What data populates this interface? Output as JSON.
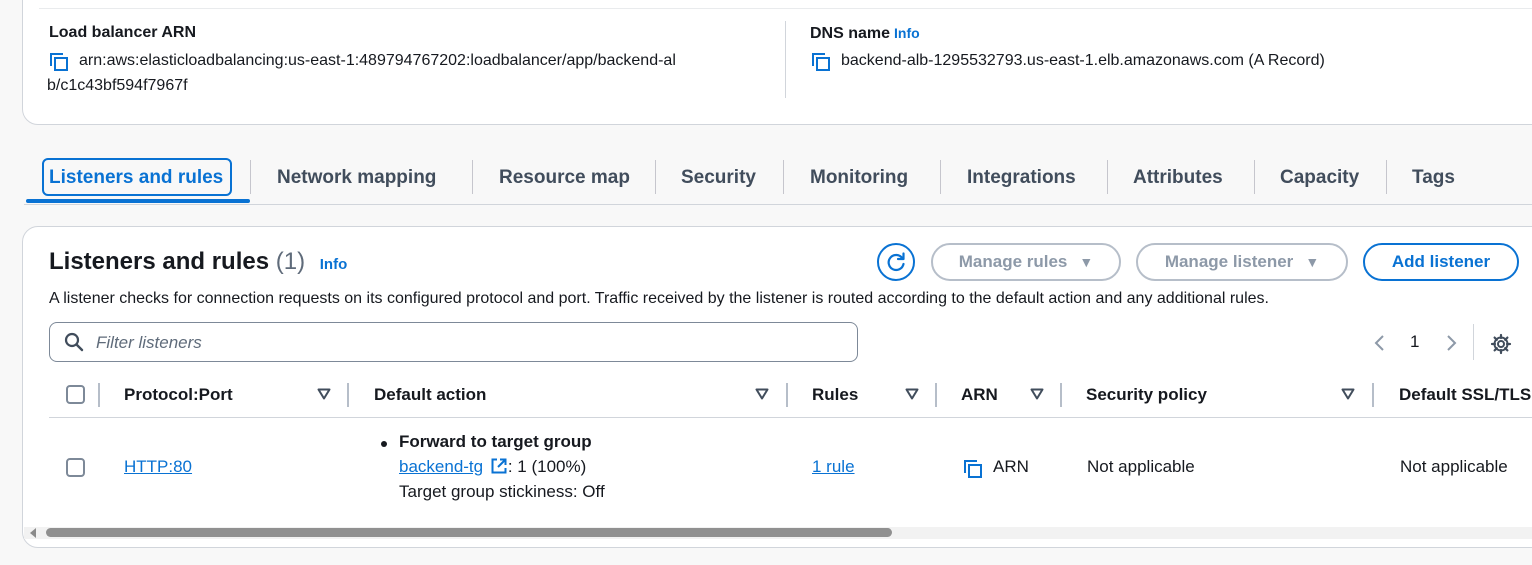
{
  "details": {
    "arn_label": "Load balancer ARN",
    "arn_value_line1": "arn:aws:elasticloadbalancing:us-east-1:489794767202:loadbalancer/app/backend-al",
    "arn_value_line2": "b/c1c43bf594f7967f",
    "dns_label": "DNS name",
    "dns_info": "Info",
    "dns_value": "backend-alb-1295532793.us-east-1.elb.amazonaws.com (A Record)"
  },
  "tabs": [
    {
      "label": "Listeners and rules",
      "active": true
    },
    {
      "label": "Network mapping"
    },
    {
      "label": "Resource map"
    },
    {
      "label": "Security"
    },
    {
      "label": "Monitoring"
    },
    {
      "label": "Integrations"
    },
    {
      "label": "Attributes"
    },
    {
      "label": "Capacity"
    },
    {
      "label": "Tags"
    }
  ],
  "listeners": {
    "title": "Listeners and rules",
    "count": "(1)",
    "info": "Info",
    "description": "A listener checks for connection requests on its configured protocol and port. Traffic received by the listener is routed according to the default action and any additional rules.",
    "buttons": {
      "manage_rules": "Manage rules",
      "manage_listener": "Manage listener",
      "add_listener": "Add listener"
    },
    "filter_placeholder": "Filter listeners",
    "page": "1",
    "columns": [
      "Protocol:Port",
      "Default action",
      "Rules",
      "ARN",
      "Security policy",
      "Default SSL/TLS"
    ],
    "rows": [
      {
        "protocol_port": "HTTP:80",
        "action_title": "Forward to target group",
        "target_group": "backend-tg",
        "target_weight": ": 1 (100%)",
        "stickiness": "Target group stickiness: Off",
        "rules": "1 rule",
        "arn": "ARN",
        "security_policy": "Not applicable",
        "default_ssl": "Not applicable"
      }
    ]
  },
  "icons": {
    "copy": "copy-icon",
    "external": "external-link-icon",
    "refresh": "refresh-icon",
    "search": "search-icon",
    "settings": "settings-gear-icon",
    "sort": "sort-caret-icon"
  },
  "colors": {
    "accent": "#0972d3",
    "text": "#16191f",
    "muted": "#5f6b7a",
    "disabled": "#8d99a8",
    "border": "#d1d5db"
  }
}
